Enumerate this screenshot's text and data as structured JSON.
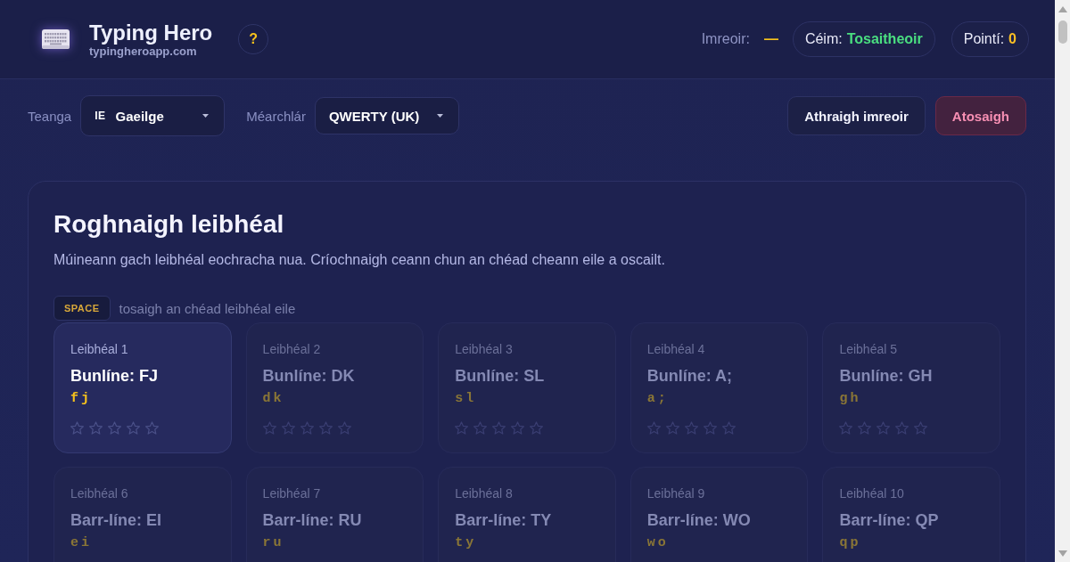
{
  "header": {
    "title": "Typing Hero",
    "subtitle": "typingheroapp.com",
    "help_button": "?",
    "player": {
      "label": "Imreoir:",
      "value": "—"
    },
    "rank": {
      "label": "Céim:",
      "value": "Tosaitheoir"
    },
    "points": {
      "label": "Pointí:",
      "value": "0"
    }
  },
  "toolbar": {
    "selects": [
      {
        "label": "Teanga",
        "flag": "IE",
        "value": "Gaeilge"
      },
      {
        "label": "Méarchlár",
        "value": "QWERTY (UK)"
      }
    ],
    "buttons": [
      {
        "label": "Athraigh imreoir",
        "kind": "secondary"
      },
      {
        "label": "Atosaigh",
        "kind": "danger"
      }
    ]
  },
  "level_panel": {
    "title": "Roghnaigh leibhéal",
    "description": "Múineann gach leibhéal eochracha nua. Críochnaigh ceann chun an chéad cheann eile a oscailt.",
    "shortcut": {
      "key": "SPACE",
      "hint": "tosaigh an chéad leibhéal eile"
    },
    "levels": [
      {
        "label": "Leibhéal 1",
        "title": "Bunlíne: FJ",
        "keys": "fj",
        "unlocked": true,
        "stars": 0
      },
      {
        "label": "Leibhéal 2",
        "title": "Bunlíne: DK",
        "keys": "dk",
        "unlocked": false,
        "stars": 0
      },
      {
        "label": "Leibhéal 3",
        "title": "Bunlíne: SL",
        "keys": "sl",
        "unlocked": false,
        "stars": 0
      },
      {
        "label": "Leibhéal 4",
        "title": "Bunlíne: A;",
        "keys": "a;",
        "unlocked": false,
        "stars": 0
      },
      {
        "label": "Leibhéal 5",
        "title": "Bunlíne: GH",
        "keys": "gh",
        "unlocked": false,
        "stars": 0
      },
      {
        "label": "Leibhéal 6",
        "title": "Barr-líne: EI",
        "keys": "ei",
        "unlocked": false
      },
      {
        "label": "Leibhéal 7",
        "title": "Barr-líne: RU",
        "keys": "ru",
        "unlocked": false
      },
      {
        "label": "Leibhéal 8",
        "title": "Barr-líne: TY",
        "keys": "ty",
        "unlocked": false
      },
      {
        "label": "Leibhéal 9",
        "title": "Barr-líne: WO",
        "keys": "wo",
        "unlocked": false
      },
      {
        "label": "Leibhéal 10",
        "title": "Barr-líne: QP",
        "keys": "qp",
        "unlocked": false
      }
    ]
  }
}
